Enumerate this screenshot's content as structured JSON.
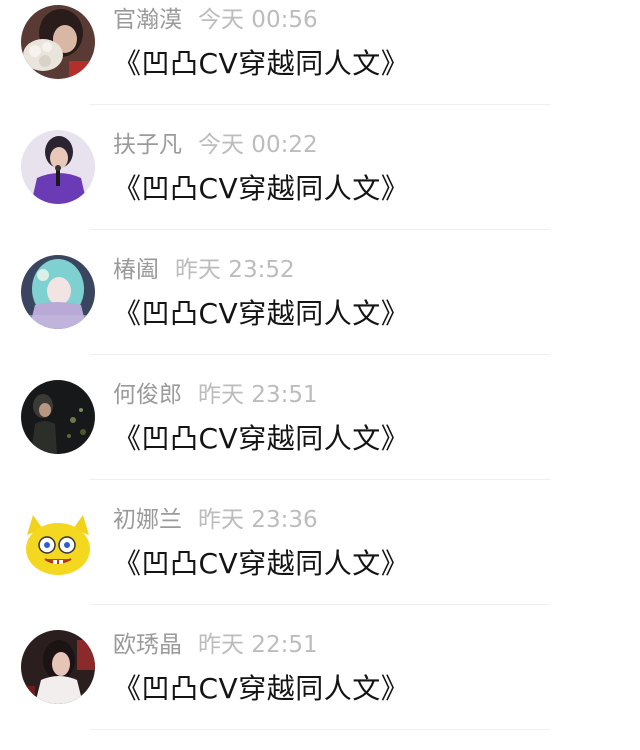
{
  "comments": [
    {
      "name": "官瀚漠",
      "time": "今天 00:56",
      "text": "《凹凸CV穿越同人文》",
      "avatar": "avatar-girl-with-flower"
    },
    {
      "name": "扶子凡",
      "time": "今天 00:22",
      "text": "《凹凸CV穿越同人文》",
      "avatar": "avatar-singer-purple"
    },
    {
      "name": "椿阖",
      "time": "昨天 23:52",
      "text": "《凹凸CV穿越同人文》",
      "avatar": "avatar-anime-teal-hair"
    },
    {
      "name": "何俊郎",
      "time": "昨天 23:51",
      "text": "《凹凸CV穿越同人文》",
      "avatar": "avatar-dark-scene"
    },
    {
      "name": "初娜兰",
      "time": "昨天 23:36",
      "text": "《凹凸CV穿越同人文》",
      "avatar": "avatar-yellow-cartoon"
    },
    {
      "name": "欧琇晶",
      "time": "昨天 22:51",
      "text": "《凹凸CV穿越同人文》",
      "avatar": "avatar-dark-red-figure"
    }
  ]
}
